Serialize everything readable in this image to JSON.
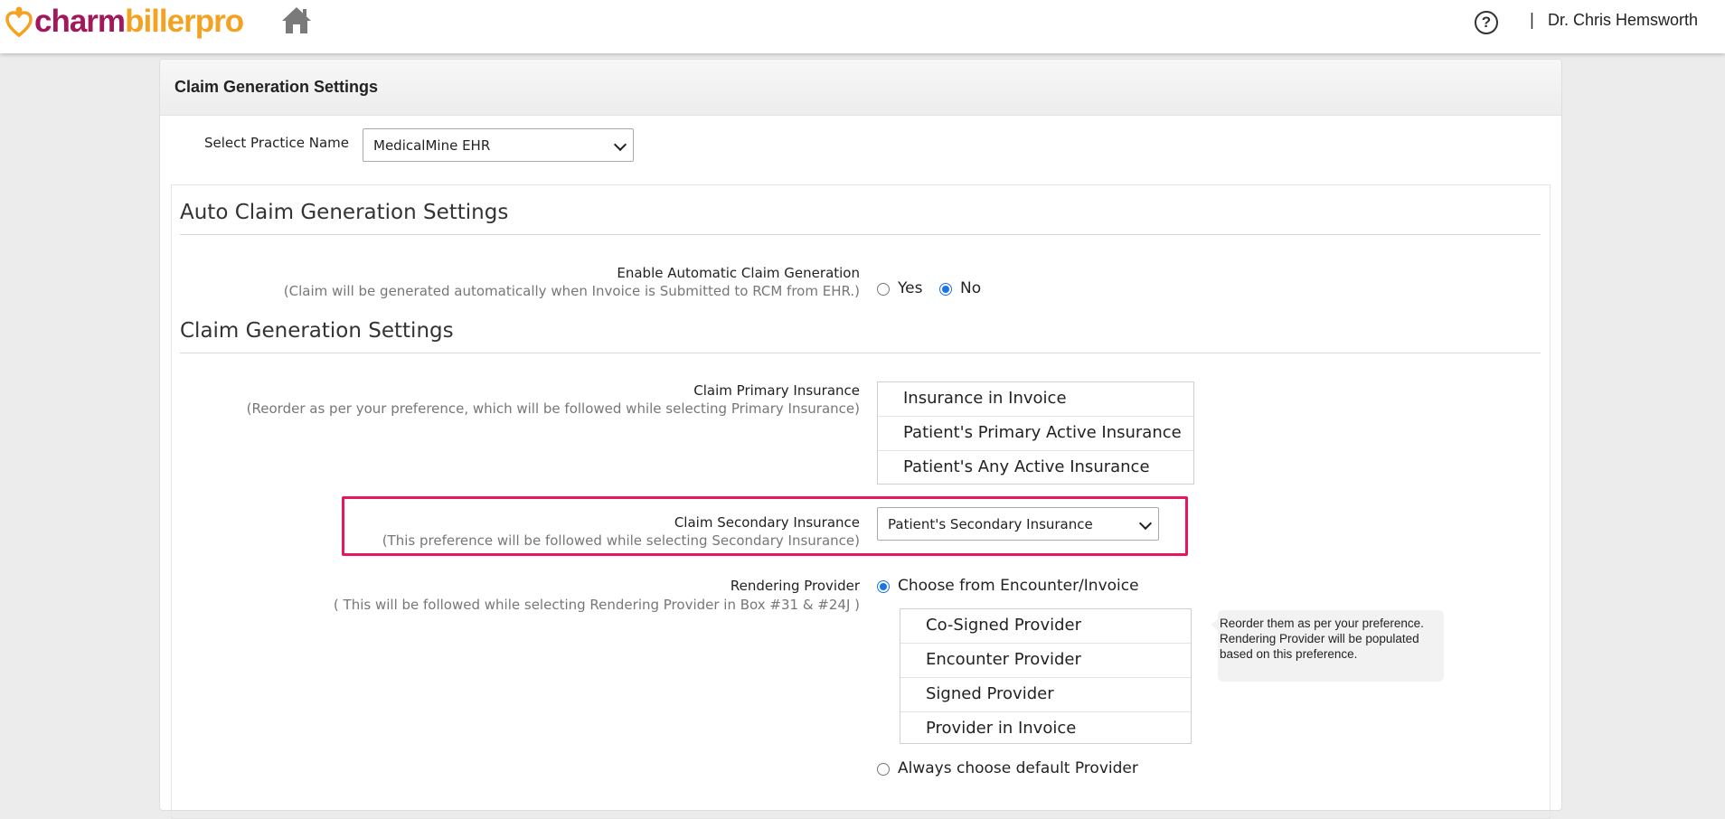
{
  "header": {
    "logo_part1": "charm",
    "logo_part2": "billerpro",
    "separator": "|",
    "user_name": "Dr. Chris Hemsworth",
    "help_glyph": "?",
    "icons": [
      "heart-logo-icon",
      "home-icon",
      "help-icon"
    ]
  },
  "panel": {
    "title": "Claim Generation Settings",
    "practice_label": "Select Practice Name",
    "practice_value": "MedicalMine EHR"
  },
  "auto_section": {
    "title": "Auto Claim Generation Settings",
    "enable_label": "Enable Automatic Claim Generation",
    "enable_sub": "(Claim will be generated automatically when Invoice is Submitted to RCM from EHR.)",
    "yes_label": "Yes",
    "no_label": "No",
    "selected": "No"
  },
  "claim_section": {
    "title": "Claim Generation Settings",
    "primary_label": "Claim Primary Insurance",
    "primary_sub": "(Reorder as per your preference, which will be followed while selecting Primary Insurance)",
    "primary_items": [
      "Insurance in Invoice",
      "Patient's Primary Active Insurance",
      "Patient's Any Active Insurance"
    ],
    "secondary_label": "Claim Secondary Insurance",
    "secondary_sub": "(This preference will be followed while selecting Secondary Insurance)",
    "secondary_value": "Patient's Secondary Insurance",
    "rendering_label": "Rendering Provider",
    "rendering_sub": "( This will be followed while selecting Rendering Provider in Box #31 & #24J )",
    "rendering_option_choose": "Choose from Encounter/Invoice",
    "rendering_option_default": "Always choose default Provider",
    "rendering_selected": "Choose from Encounter/Invoice",
    "rendering_items": [
      "Co-Signed Provider",
      "Encounter Provider",
      "Signed Provider",
      "Provider in Invoice"
    ],
    "rendering_tooltip": "Reorder them as per your preference. Rendering Provider will be populated based on this preference."
  },
  "colors": {
    "logo_primary": "#a2195b",
    "logo_secondary": "#f4a221",
    "highlight": "#e8175d",
    "radio_accent": "#1a73e8"
  }
}
